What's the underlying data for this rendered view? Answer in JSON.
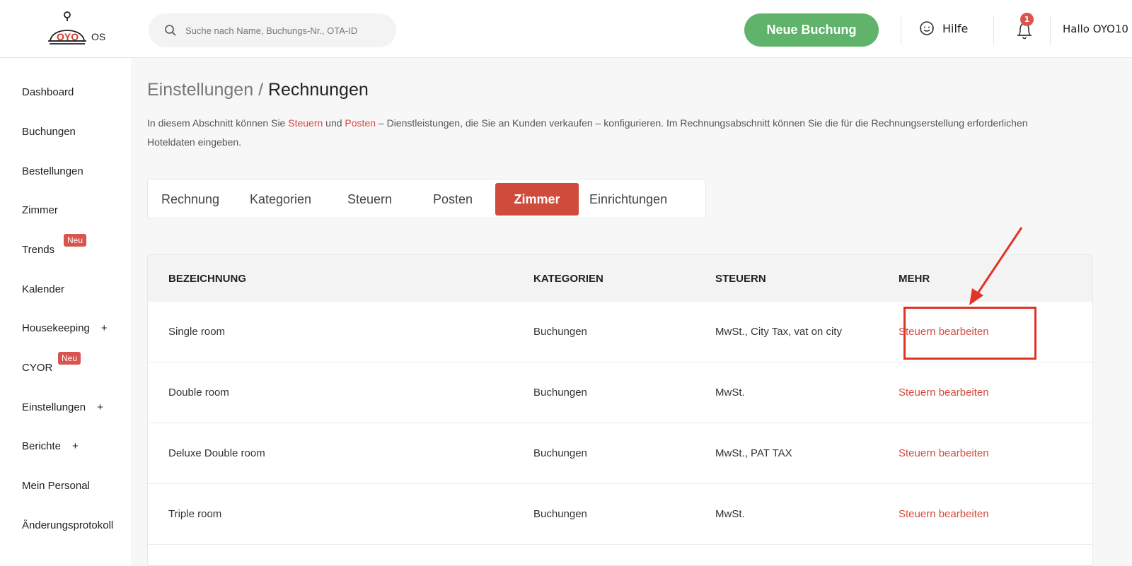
{
  "header": {
    "logo_text": "OYO",
    "logo_suffix": "OS",
    "search_placeholder": "Suche nach Name, Buchungs-Nr., OTA-ID",
    "new_booking_label": "Neue Buchung",
    "help_label": "Hilfe",
    "notification_count": "1",
    "greeting": "Hallo OYO10"
  },
  "sidebar": {
    "items": [
      {
        "label": "Dashboard"
      },
      {
        "label": "Buchungen"
      },
      {
        "label": "Bestellungen"
      },
      {
        "label": "Zimmer"
      },
      {
        "label": "Trends",
        "badge": "Neu"
      },
      {
        "label": "Kalender"
      },
      {
        "label": "Housekeeping",
        "plus": "+"
      },
      {
        "label": "CYOR",
        "badge": "Neu"
      },
      {
        "label": "Einstellungen",
        "plus": "+"
      },
      {
        "label": "Berichte",
        "plus": "+"
      },
      {
        "label": "Mein Personal"
      },
      {
        "label": "Änderungsprotokoll"
      }
    ]
  },
  "page": {
    "breadcrumb_parent": "Einstellungen",
    "breadcrumb_sep": " / ",
    "breadcrumb_current": "Rechnungen",
    "desc_part1": "In diesem Abschnitt können Sie ",
    "desc_link1": "Steuern",
    "desc_part2": " und ",
    "desc_link2": "Posten",
    "desc_part3": " – Dienstleistungen, die Sie an Kunden verkaufen – konfigurieren. Im Rechnungsabschnitt können Sie die für die Rechnungserstellung erforderlichen Hoteldaten eingeben."
  },
  "tabs": [
    {
      "label": "Rechnung"
    },
    {
      "label": "Kategorien"
    },
    {
      "label": "Steuern"
    },
    {
      "label": "Posten"
    },
    {
      "label": "Zimmer",
      "active": true
    },
    {
      "label": "Einrichtungen"
    }
  ],
  "table": {
    "headers": [
      "BEZEICHNUNG",
      "KATEGORIEN",
      "STEUERN",
      "MEHR"
    ],
    "rows": [
      {
        "name": "Single room",
        "category": "Buchungen",
        "taxes": "MwSt., City Tax, vat on city",
        "action": "Steuern bearbeiten"
      },
      {
        "name": "Double room",
        "category": "Buchungen",
        "taxes": "MwSt.",
        "action": "Steuern bearbeiten"
      },
      {
        "name": "Deluxe Double room",
        "category": "Buchungen",
        "taxes": "MwSt., PAT TAX",
        "action": "Steuern bearbeiten"
      },
      {
        "name": "Triple room",
        "category": "Buchungen",
        "taxes": "MwSt.",
        "action": "Steuern bearbeiten"
      }
    ]
  },
  "colors": {
    "accent": "#cf4b3c",
    "primary_button": "#5fb36a",
    "annotation": "#e03427"
  }
}
